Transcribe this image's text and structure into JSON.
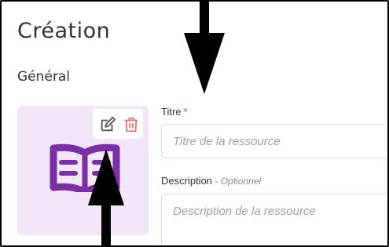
{
  "page": {
    "title": "Création"
  },
  "section": {
    "title": "Général"
  },
  "form": {
    "title_label": "Titre",
    "required_mark": "*",
    "title_placeholder": "Titre de la ressource",
    "description_label": "Description",
    "optional_prefix": " - ",
    "optional_label": "Optionnel",
    "description_placeholder": "Description de la ressource"
  },
  "image": {
    "icon": "open-book-icon",
    "actions": [
      "edit-icon",
      "delete-icon"
    ]
  },
  "colors": {
    "accent": "#7b2fa6",
    "thumb_bg": "#f1e7f8",
    "danger": "#e57373",
    "required": "#e53935"
  }
}
